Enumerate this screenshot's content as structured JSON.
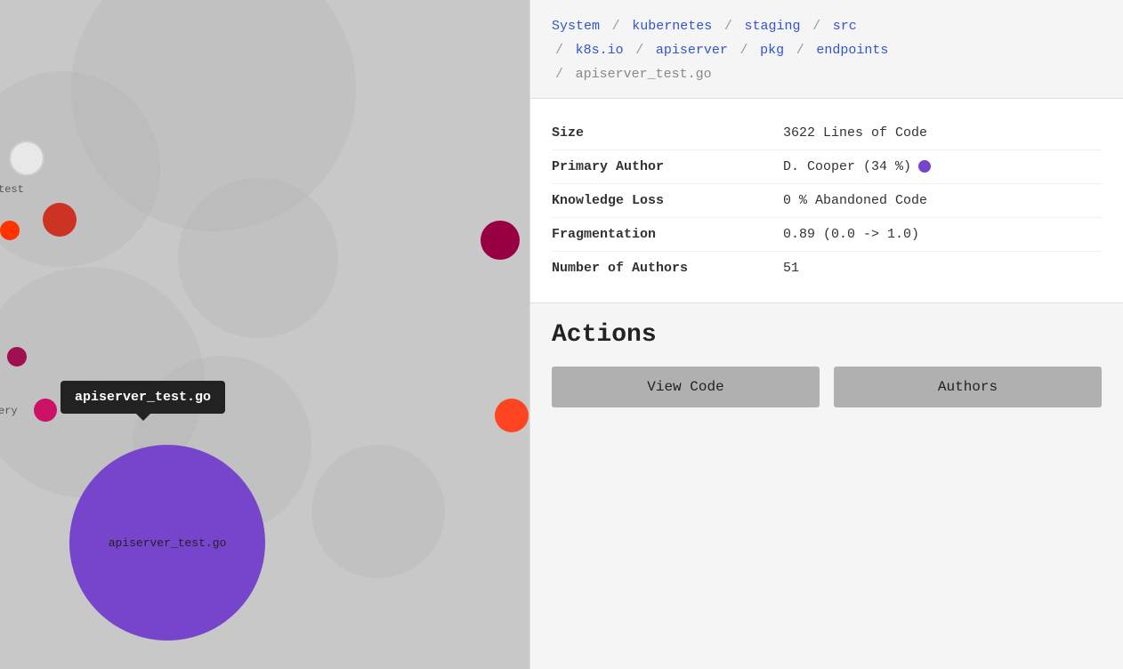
{
  "breadcrumb": {
    "items": [
      {
        "label": "System",
        "active": true
      },
      {
        "label": "kubernetes",
        "active": true
      },
      {
        "label": "staging",
        "active": true
      },
      {
        "label": "src",
        "active": true
      },
      {
        "label": "k8s.io",
        "active": true
      },
      {
        "label": "apiserver",
        "active": true
      },
      {
        "label": "pkg",
        "active": true
      },
      {
        "label": "endpoints",
        "active": true
      },
      {
        "label": "apiserver_test.go",
        "active": false
      }
    ],
    "separator": "/"
  },
  "info": {
    "rows": [
      {
        "label": "Size",
        "value": "3622 Lines of Code"
      },
      {
        "label": "Primary Author",
        "value": "D. Cooper (34 %)",
        "has_dot": true
      },
      {
        "label": "Knowledge Loss",
        "value": "0 % Abandoned Code"
      },
      {
        "label": "Fragmentation",
        "value": "0.89 (0.0 -> 1.0)"
      },
      {
        "label": "Number of Authors",
        "value": "51"
      }
    ]
  },
  "actions": {
    "title": "Actions",
    "buttons": [
      {
        "label": "View Code",
        "name": "view-code-button"
      },
      {
        "label": "Authors",
        "name": "authors-button"
      }
    ]
  },
  "tooltip": {
    "text": "apiserver_test.go"
  },
  "visualization": {
    "label": "apiserver_test.go"
  }
}
